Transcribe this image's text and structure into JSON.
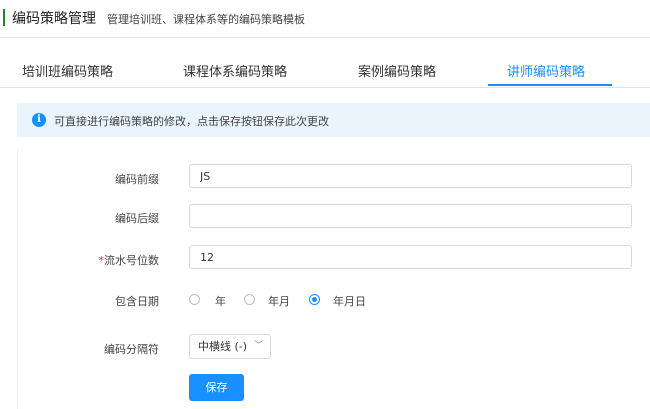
{
  "header": {
    "title": "编码策略管理",
    "subtitle": "管理培训班、课程体系等的编码策略模板"
  },
  "tabs": [
    {
      "label": "培训班编码策略",
      "active": false
    },
    {
      "label": "课程体系编码策略",
      "active": false
    },
    {
      "label": "案例编码策略",
      "active": false
    },
    {
      "label": "讲师编码策略",
      "active": true
    }
  ],
  "notice": {
    "icon": "info-icon",
    "icon_glyph": "i",
    "text": "可直接进行编码策略的修改，点击保存按钮保存此次更改"
  },
  "form": {
    "prefix": {
      "label": "编码前缀",
      "value": "JS"
    },
    "suffix": {
      "label": "编码后缀",
      "value": ""
    },
    "serial": {
      "required_mark": "*",
      "label": "流水号位数",
      "value": "12"
    },
    "date": {
      "label": "包含日期",
      "options": [
        {
          "label": "年",
          "checked": false
        },
        {
          "label": "年月",
          "checked": false
        },
        {
          "label": "年月日",
          "checked": true
        }
      ]
    },
    "separator": {
      "label": "编码分隔符",
      "selected": "中横线 (-)",
      "chevron": "﹀"
    },
    "save_label": "保存"
  },
  "colors": {
    "accent": "#1890ff",
    "header_bar": "#2e7d32",
    "notice_bg": "#eaf4fd",
    "required": "#f5222d"
  }
}
